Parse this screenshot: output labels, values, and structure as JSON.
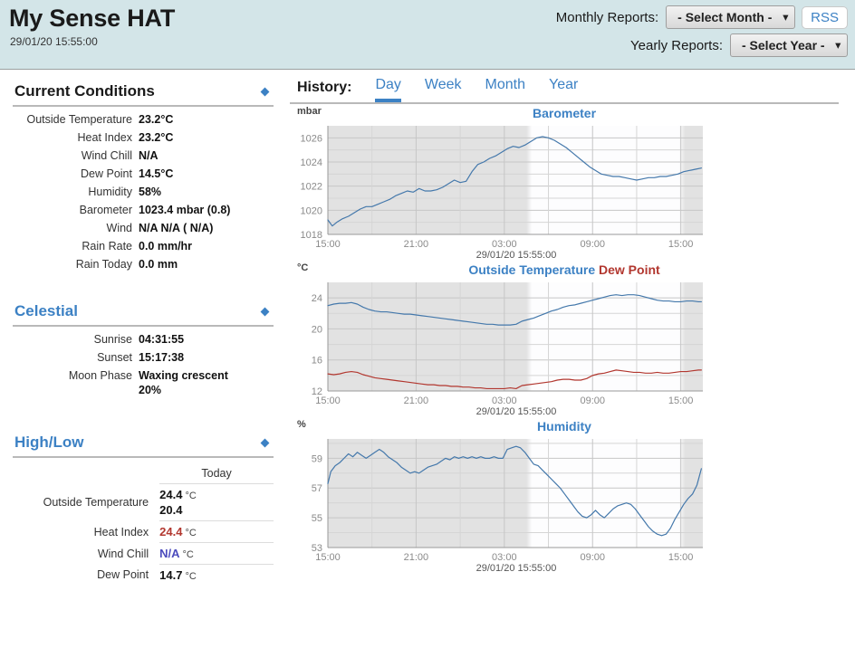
{
  "header": {
    "title": "My Sense HAT",
    "timestamp": "29/01/20 15:55:00",
    "monthly_label": "Monthly Reports:",
    "monthly_value": "- Select Month -",
    "yearly_label": "Yearly Reports:",
    "yearly_value": "- Select Year -",
    "rss_label": "RSS"
  },
  "current": {
    "title": "Current Conditions",
    "rows": [
      {
        "label": "Outside Temperature",
        "value": "23.2°C"
      },
      {
        "label": "Heat Index",
        "value": "23.2°C"
      },
      {
        "label": "Wind Chill",
        "value": "N/A"
      },
      {
        "label": "Dew Point",
        "value": "14.5°C"
      },
      {
        "label": "Humidity",
        "value": "58%"
      },
      {
        "label": "Barometer",
        "value": "1023.4 mbar (0.8)"
      },
      {
        "label": "Wind",
        "value": "N/A N/A ( N/A)"
      },
      {
        "label": "Rain Rate",
        "value": "0.0 mm/hr"
      },
      {
        "label": "Rain Today",
        "value": "0.0 mm"
      }
    ]
  },
  "celestial": {
    "title": "Celestial",
    "rows": [
      {
        "label": "Sunrise",
        "value": "04:31:55"
      },
      {
        "label": "Sunset",
        "value": "15:17:38"
      }
    ],
    "moon_label": "Moon Phase",
    "moon_phase": "Waxing crescent",
    "moon_pct": "20%"
  },
  "highlow": {
    "title": "High/Low",
    "column": "Today",
    "rows": [
      {
        "label": "Outside Temperature",
        "high": "24.4",
        "unit": "°C",
        "low": "20.4",
        "color": "black"
      },
      {
        "label": "Heat Index",
        "high": "24.4",
        "unit": "°C",
        "low": "",
        "color": "red"
      },
      {
        "label": "Wind Chill",
        "high": "N/A",
        "unit": "°C",
        "low": "",
        "color": "blue"
      },
      {
        "label": "Dew Point",
        "high": "14.7",
        "unit": "°C",
        "low": "",
        "color": "black"
      }
    ]
  },
  "history": {
    "label": "History:",
    "tabs": [
      {
        "label": "Day",
        "active": true
      },
      {
        "label": "Week",
        "active": false
      },
      {
        "label": "Month",
        "active": false
      },
      {
        "label": "Year",
        "active": false
      }
    ]
  },
  "chart_data": [
    {
      "type": "line",
      "name": "barometer",
      "title": "Barometer",
      "ylabel": "mbar",
      "xlabel": "29/01/20 15:55:00",
      "ylim": [
        1018,
        1027
      ],
      "yticks": [
        1018,
        1020,
        1022,
        1024,
        1026
      ],
      "xticks": [
        "15:00",
        "21:00",
        "03:00",
        "09:00",
        "15:00"
      ],
      "xtick_hours": [
        15,
        21,
        27,
        33,
        39
      ],
      "xlim_hours": [
        15,
        40.5
      ],
      "grid": true,
      "daylight_band_hours": [
        28.5,
        39.3
      ],
      "series": [
        {
          "name": "Barometer",
          "color": "#4478ab",
          "x_hours": [
            15.0,
            15.3,
            15.6,
            16.0,
            16.4,
            16.8,
            17.2,
            17.6,
            18.0,
            18.4,
            18.8,
            19.2,
            19.6,
            20.0,
            20.4,
            20.8,
            21.2,
            21.6,
            22.0,
            22.4,
            22.8,
            23.2,
            23.6,
            24.0,
            24.4,
            24.8,
            25.2,
            25.6,
            26.0,
            26.4,
            26.8,
            27.2,
            27.6,
            28.0,
            28.4,
            28.8,
            29.2,
            29.6,
            30.0,
            30.4,
            30.8,
            31.2,
            31.6,
            32.0,
            32.4,
            32.8,
            33.2,
            33.6,
            34.0,
            34.4,
            34.8,
            35.2,
            35.6,
            36.0,
            36.4,
            36.8,
            37.2,
            37.6,
            38.0,
            38.4,
            38.8,
            39.2,
            39.6,
            40.0,
            40.4
          ],
          "values": [
            1019.2,
            1018.7,
            1019.0,
            1019.3,
            1019.5,
            1019.8,
            1020.1,
            1020.3,
            1020.3,
            1020.5,
            1020.7,
            1020.9,
            1021.2,
            1021.4,
            1021.6,
            1021.5,
            1021.8,
            1021.6,
            1021.6,
            1021.7,
            1021.9,
            1022.2,
            1022.5,
            1022.3,
            1022.4,
            1023.2,
            1023.8,
            1024.0,
            1024.3,
            1024.5,
            1024.8,
            1025.1,
            1025.3,
            1025.2,
            1025.4,
            1025.7,
            1026.0,
            1026.1,
            1026.0,
            1025.8,
            1025.5,
            1025.2,
            1024.8,
            1024.4,
            1024.0,
            1023.6,
            1023.3,
            1023.0,
            1022.9,
            1022.8,
            1022.8,
            1022.7,
            1022.6,
            1022.5,
            1022.6,
            1022.7,
            1022.7,
            1022.8,
            1022.8,
            1022.9,
            1023.0,
            1023.2,
            1023.3,
            1023.4,
            1023.5
          ]
        }
      ]
    },
    {
      "type": "line",
      "name": "temperature",
      "title": "Outside Temperature",
      "title2": "Dew Point",
      "ylabel": "°C",
      "xlabel": "29/01/20 15:55:00",
      "ylim": [
        12,
        26
      ],
      "yticks": [
        12,
        16,
        20,
        24
      ],
      "xticks": [
        "15:00",
        "21:00",
        "03:00",
        "09:00",
        "15:00"
      ],
      "xtick_hours": [
        15,
        21,
        27,
        33,
        39
      ],
      "xlim_hours": [
        15,
        40.5
      ],
      "grid": true,
      "daylight_band_hours": [
        28.5,
        39.3
      ],
      "series": [
        {
          "name": "Outside Temperature",
          "color": "#4478ab",
          "x_hours": [
            15.0,
            15.4,
            15.8,
            16.2,
            16.6,
            17.0,
            17.4,
            17.8,
            18.2,
            18.6,
            19.0,
            19.4,
            19.8,
            20.2,
            20.6,
            21.0,
            21.4,
            21.8,
            22.2,
            22.6,
            23.0,
            23.4,
            23.8,
            24.2,
            24.6,
            25.0,
            25.4,
            25.8,
            26.2,
            26.6,
            27.0,
            27.4,
            27.8,
            28.2,
            28.6,
            29.0,
            29.4,
            29.8,
            30.2,
            30.6,
            31.0,
            31.4,
            31.8,
            32.2,
            32.6,
            33.0,
            33.4,
            33.8,
            34.2,
            34.6,
            35.0,
            35.4,
            35.8,
            36.2,
            36.6,
            37.0,
            37.4,
            37.8,
            38.2,
            38.6,
            39.0,
            39.4,
            39.8,
            40.2,
            40.4
          ],
          "values": [
            23.0,
            23.2,
            23.3,
            23.3,
            23.4,
            23.2,
            22.8,
            22.5,
            22.3,
            22.2,
            22.2,
            22.1,
            22.0,
            21.9,
            21.9,
            21.8,
            21.7,
            21.6,
            21.5,
            21.4,
            21.3,
            21.2,
            21.1,
            21.0,
            20.9,
            20.8,
            20.7,
            20.6,
            20.6,
            20.5,
            20.5,
            20.5,
            20.6,
            21.0,
            21.2,
            21.4,
            21.7,
            22.0,
            22.3,
            22.5,
            22.8,
            23.0,
            23.1,
            23.3,
            23.5,
            23.7,
            23.9,
            24.1,
            24.3,
            24.4,
            24.3,
            24.4,
            24.4,
            24.3,
            24.1,
            23.9,
            23.7,
            23.6,
            23.6,
            23.5,
            23.5,
            23.6,
            23.6,
            23.5,
            23.5
          ]
        },
        {
          "name": "Dew Point",
          "color": "#b2372f",
          "x_hours": [
            15.0,
            15.4,
            15.8,
            16.2,
            16.6,
            17.0,
            17.4,
            17.8,
            18.2,
            18.6,
            19.0,
            19.4,
            19.8,
            20.2,
            20.6,
            21.0,
            21.4,
            21.8,
            22.2,
            22.6,
            23.0,
            23.4,
            23.8,
            24.2,
            24.6,
            25.0,
            25.4,
            25.8,
            26.2,
            26.6,
            27.0,
            27.4,
            27.8,
            28.2,
            28.6,
            29.0,
            29.4,
            29.8,
            30.2,
            30.6,
            31.0,
            31.4,
            31.8,
            32.2,
            32.6,
            33.0,
            33.4,
            33.8,
            34.2,
            34.6,
            35.0,
            35.4,
            35.8,
            36.2,
            36.6,
            37.0,
            37.4,
            37.8,
            38.2,
            38.6,
            39.0,
            39.4,
            39.8,
            40.2,
            40.4
          ],
          "values": [
            14.2,
            14.1,
            14.2,
            14.4,
            14.5,
            14.4,
            14.1,
            13.9,
            13.7,
            13.6,
            13.5,
            13.4,
            13.3,
            13.2,
            13.1,
            13.0,
            12.9,
            12.8,
            12.8,
            12.7,
            12.7,
            12.6,
            12.6,
            12.5,
            12.5,
            12.4,
            12.4,
            12.3,
            12.3,
            12.3,
            12.3,
            12.4,
            12.3,
            12.7,
            12.8,
            12.9,
            13.0,
            13.1,
            13.2,
            13.4,
            13.5,
            13.5,
            13.4,
            13.4,
            13.6,
            14.0,
            14.2,
            14.3,
            14.5,
            14.7,
            14.6,
            14.5,
            14.4,
            14.4,
            14.3,
            14.3,
            14.4,
            14.3,
            14.3,
            14.4,
            14.5,
            14.5,
            14.6,
            14.7,
            14.7
          ]
        }
      ]
    },
    {
      "type": "line",
      "name": "humidity",
      "title": "Humidity",
      "ylabel": "%",
      "xlabel": "29/01/20 15:55:00",
      "ylim": [
        53,
        60.3
      ],
      "yticks": [
        53,
        55,
        57,
        59
      ],
      "xticks": [
        "15:00",
        "21:00",
        "03:00",
        "09:00",
        "15:00"
      ],
      "xtick_hours": [
        15,
        21,
        27,
        33,
        39
      ],
      "xlim_hours": [
        15,
        40.5
      ],
      "grid": true,
      "daylight_band_hours": [
        28.5,
        39.3
      ],
      "series": [
        {
          "name": "Humidity",
          "color": "#4478ab",
          "x_hours": [
            15.0,
            15.2,
            15.5,
            15.8,
            16.1,
            16.4,
            16.7,
            17.0,
            17.3,
            17.6,
            17.9,
            18.2,
            18.5,
            18.8,
            19.1,
            19.4,
            19.7,
            20.0,
            20.3,
            20.6,
            20.9,
            21.2,
            21.5,
            21.8,
            22.1,
            22.4,
            22.7,
            23.0,
            23.3,
            23.6,
            23.9,
            24.2,
            24.5,
            24.8,
            25.1,
            25.4,
            25.7,
            26.0,
            26.3,
            26.6,
            26.9,
            27.2,
            27.5,
            27.8,
            28.1,
            28.4,
            28.7,
            29.0,
            29.3,
            29.6,
            29.9,
            30.2,
            30.5,
            30.8,
            31.1,
            31.4,
            31.7,
            32.0,
            32.3,
            32.6,
            32.9,
            33.2,
            33.5,
            33.8,
            34.1,
            34.4,
            34.7,
            35.0,
            35.3,
            35.6,
            35.9,
            36.2,
            36.5,
            36.8,
            37.1,
            37.4,
            37.7,
            38.0,
            38.3,
            38.6,
            38.9,
            39.2,
            39.5,
            39.8,
            40.1,
            40.4
          ],
          "values": [
            57.3,
            58.1,
            58.5,
            58.7,
            59.0,
            59.3,
            59.1,
            59.4,
            59.2,
            59.0,
            59.2,
            59.4,
            59.6,
            59.4,
            59.1,
            58.9,
            58.7,
            58.4,
            58.2,
            58.0,
            58.1,
            58.0,
            58.2,
            58.4,
            58.5,
            58.6,
            58.8,
            59.0,
            58.9,
            59.1,
            59.0,
            59.1,
            59.0,
            59.1,
            59.0,
            59.1,
            59.0,
            59.0,
            59.1,
            59.0,
            59.0,
            59.6,
            59.7,
            59.8,
            59.7,
            59.4,
            59.0,
            58.6,
            58.5,
            58.2,
            57.9,
            57.6,
            57.3,
            57.0,
            56.6,
            56.2,
            55.8,
            55.4,
            55.1,
            55.0,
            55.2,
            55.5,
            55.2,
            55.0,
            55.3,
            55.6,
            55.8,
            55.9,
            56.0,
            55.9,
            55.6,
            55.2,
            54.8,
            54.4,
            54.1,
            53.9,
            53.8,
            53.9,
            54.3,
            54.9,
            55.4,
            55.9,
            56.3,
            56.6,
            57.2,
            58.3
          ]
        }
      ]
    }
  ]
}
